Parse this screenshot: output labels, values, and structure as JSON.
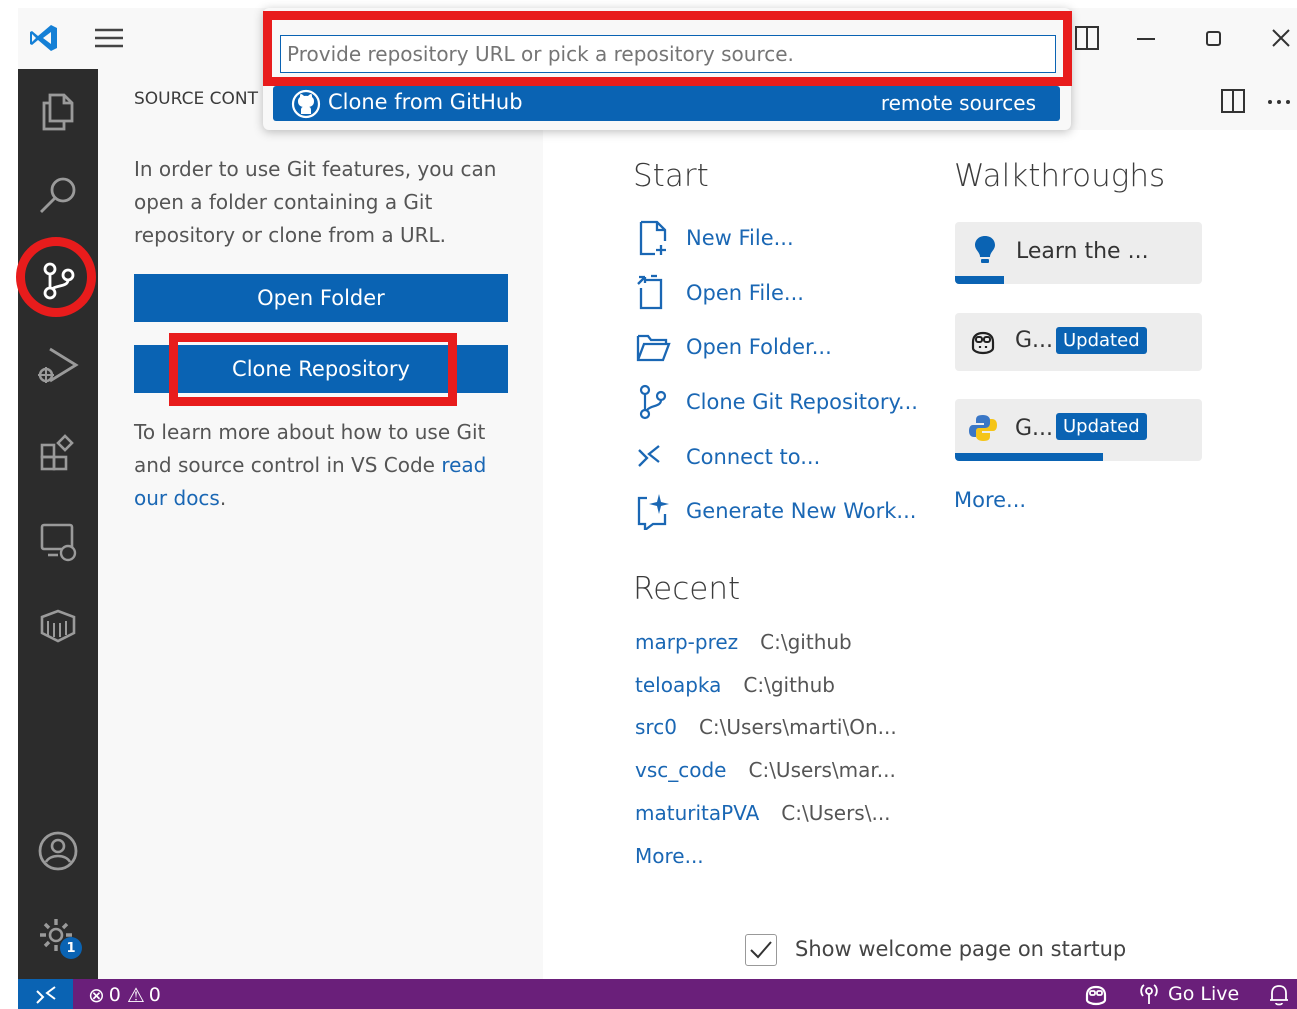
{
  "quick_pick": {
    "placeholder": "Provide repository URL or pick a repository source.",
    "item_label": "Clone from GitHub",
    "item_detail": "remote sources"
  },
  "sidebar": {
    "title": "SOURCE CONT",
    "intro_line1": "In order to use Git features, you can",
    "intro_line2": "open a folder containing a Git",
    "intro_line3": "repository or clone from a URL.",
    "open_folder_label": "Open Folder",
    "clone_repo_label": "Clone Repository",
    "learn_line1": "To learn more about how to use Git",
    "learn_line2_text": "and source control in VS Code",
    "learn_link_a": "read",
    "learn_link_b": "our docs",
    "learn_end": "."
  },
  "welcome": {
    "start_title": "Start",
    "start_items": [
      {
        "label": "New File...",
        "icon": "new-file-icon"
      },
      {
        "label": "Open File...",
        "icon": "open-file-icon"
      },
      {
        "label": "Open Folder...",
        "icon": "folder-icon"
      },
      {
        "label": "Clone Git Repository...",
        "icon": "source-control-icon"
      },
      {
        "label": "Connect to...",
        "icon": "remote-icon"
      },
      {
        "label": "Generate New Work...",
        "icon": "sparkle-icon"
      }
    ],
    "recent_title": "Recent",
    "recent": [
      {
        "name": "marp-prez",
        "path": "C:\\github"
      },
      {
        "name": "teloapka",
        "path": "C:\\github"
      },
      {
        "name": "src0",
        "path": "C:\\Users\\marti\\On..."
      },
      {
        "name": "vsc_code",
        "path": "C:\\Users\\mar..."
      },
      {
        "name": "maturitaPVA",
        "path": "C:\\Users\\..."
      }
    ],
    "recent_more": "More...",
    "walkthroughs_title": "Walkthroughs",
    "walkthroughs": [
      {
        "label": "Learn the ...",
        "icon": "lightbulb-icon",
        "badge": "",
        "progress": 0.2
      },
      {
        "label": "G...",
        "icon": "copilot-icon",
        "badge": "Updated",
        "progress": 0
      },
      {
        "label": "G...",
        "icon": "python-icon",
        "badge": "Updated",
        "progress": 0.6
      }
    ],
    "walkthroughs_more": "More...",
    "show_on_startup_label": "Show welcome page on startup",
    "show_on_startup_checked": true
  },
  "statusbar": {
    "errors": "0",
    "warnings": "0",
    "go_live": "Go Live"
  },
  "activity_bar": {
    "settings_badge": "1"
  },
  "colors": {
    "accent": "#0a63b3",
    "link": "#1a67b4",
    "statusbar": "#6a1f7a",
    "activitybar": "#2c2c2c",
    "highlight": "#e81c1c"
  }
}
